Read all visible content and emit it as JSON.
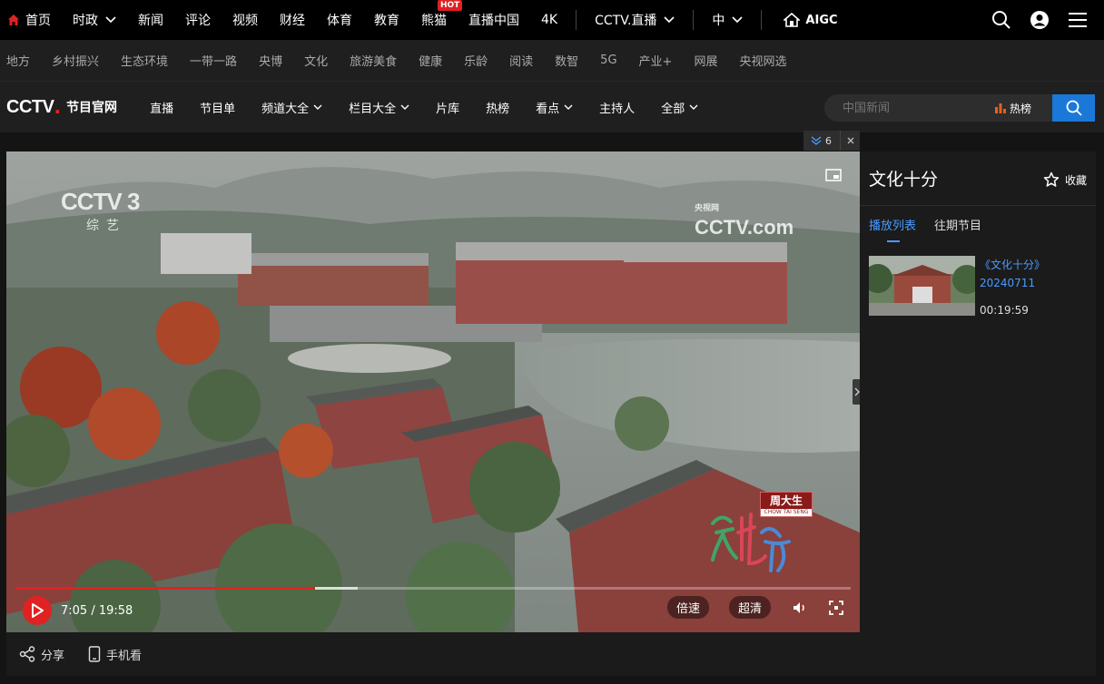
{
  "topbar": {
    "items": [
      "首页",
      "时政",
      "新闻",
      "评论",
      "视频",
      "财经",
      "体育",
      "教育",
      "熊猫",
      "直播中国",
      "4K",
      "CCTV.直播",
      "中"
    ],
    "hot_badge": "HOT",
    "aigc_label": "AIGC"
  },
  "subbar": {
    "items": [
      "地方",
      "乡村振兴",
      "生态环境",
      "一带一路",
      "央博",
      "文化",
      "旅游美食",
      "健康",
      "乐龄",
      "阅读",
      "数智",
      "5G",
      "产业+",
      "网展",
      "央视网选"
    ]
  },
  "cctvbar": {
    "logo_text": "CCTV",
    "logo_dot": ".",
    "site_name": "节目官网",
    "nav": [
      "直播",
      "节目单",
      "频道大全",
      "栏目大全",
      "片库",
      "热榜",
      "看点",
      "主持人",
      "全部"
    ],
    "search_placeholder": "中国新闻",
    "hot_rank_label": "热榜"
  },
  "fold_tab": {
    "count": "6"
  },
  "player": {
    "channel_logo": "CCTV 3",
    "channel_sub": "综艺",
    "watermark": "CCTV",
    "watermark_com": ".com",
    "watermark_small": "央视网",
    "sponsor_cn": "周大生",
    "sponsor_en": "CHOW TAI SENG",
    "time_current": "7:05",
    "time_total": "19:58",
    "time_display": "7:05 / 19:58",
    "played_fraction": 0.359,
    "buffered_fraction": 0.41,
    "speed_label": "倍速",
    "quality_label": "超清"
  },
  "belowbar": {
    "share_label": "分享",
    "mobile_label": "手机看"
  },
  "sidebar": {
    "title": "文化十分",
    "favorite_label": "收藏",
    "tabs": [
      "播放列表",
      "往期节目"
    ],
    "episode": {
      "title": "《文化十分》",
      "date": "20240711",
      "duration": "00:19:59"
    }
  },
  "colors": {
    "accent_red": "#e02222",
    "link_blue": "#4a9bff",
    "search_blue": "#1a78d8"
  }
}
